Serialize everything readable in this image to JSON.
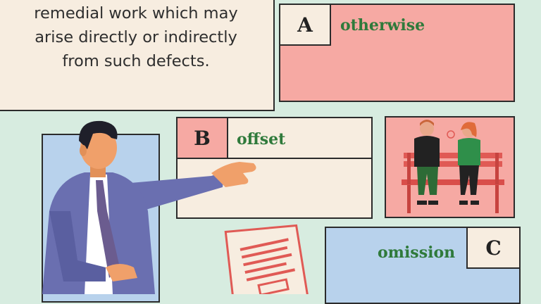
{
  "prompt": {
    "text": "remedial work which may\narise directly or indirectly\nfrom such defects."
  },
  "options": [
    {
      "letter": "A",
      "word": "otherwise"
    },
    {
      "letter": "B",
      "word": "offset"
    },
    {
      "letter": "C",
      "word": "omission"
    }
  ],
  "colors": {
    "background": "#d7ece0",
    "cream": "#f7ede0",
    "pink": "#f6a9a3",
    "blue": "#b8d2ec",
    "answer_green": "#2f7a3b"
  }
}
